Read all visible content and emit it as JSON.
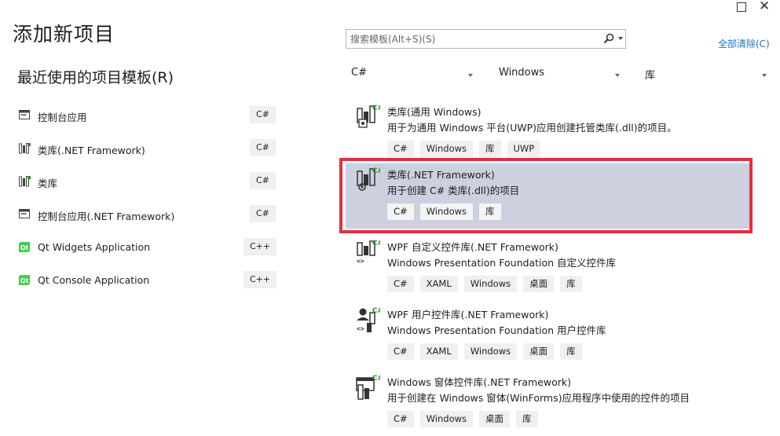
{
  "dialog": {
    "title": "添加新项目"
  },
  "recent": {
    "title": "最近使用的项目模板(R)",
    "items": [
      {
        "label": "控制台应用",
        "lang": "C#",
        "icon": "console-app-icon"
      },
      {
        "label": "类库(.NET Framework)",
        "lang": "C#",
        "icon": "class-library-icon"
      },
      {
        "label": "类库",
        "lang": "C#",
        "icon": "class-library-icon"
      },
      {
        "label": "控制台应用(.NET Framework)",
        "lang": "C#",
        "icon": "console-app-icon"
      },
      {
        "label": "Qt Widgets Application",
        "lang": "C++",
        "icon": "qt-icon"
      },
      {
        "label": "Qt Console Application",
        "lang": "C++",
        "icon": "qt-icon"
      }
    ]
  },
  "search": {
    "placeholder": "搜索模板(Alt+S)(S)"
  },
  "clear_all": "全部清除(C)",
  "filters": {
    "language": "C#",
    "platform": "Windows",
    "project_type": "库"
  },
  "templates": [
    {
      "name": "类库(通用 Windows)",
      "description": "用于为通用 Windows 平台(UWP)应用创建托管类库(.dll)的项目。",
      "tags": [
        "C#",
        "Windows",
        "库",
        "UWP"
      ],
      "selected": false
    },
    {
      "name": "类库(.NET Framework)",
      "description": "用于创建 C# 类库(.dll)的项目",
      "tags": [
        "C#",
        "Windows",
        "库"
      ],
      "selected": true
    },
    {
      "name": "WPF 自定义控件库(.NET Framework)",
      "description": "Windows Presentation Foundation 自定义控件库",
      "tags": [
        "C#",
        "XAML",
        "Windows",
        "桌面",
        "库"
      ],
      "selected": false
    },
    {
      "name": "WPF 用户控件库(.NET Framework)",
      "description": "Windows Presentation Foundation 用户控件库",
      "tags": [
        "C#",
        "XAML",
        "Windows",
        "桌面",
        "库"
      ],
      "selected": false
    },
    {
      "name": "Windows 窗体控件库(.NET Framework)",
      "description": "用于创建在 Windows 窗体(WinForms)应用程序中使用的控件的项目",
      "tags": [
        "C#",
        "Windows",
        "桌面",
        "库"
      ],
      "selected": false
    }
  ],
  "colors": {
    "accent_link": "#1a73c8",
    "selected_bg": "#ccd0df",
    "highlight_border": "#e0313b",
    "csharp_badge": "#388a34"
  }
}
